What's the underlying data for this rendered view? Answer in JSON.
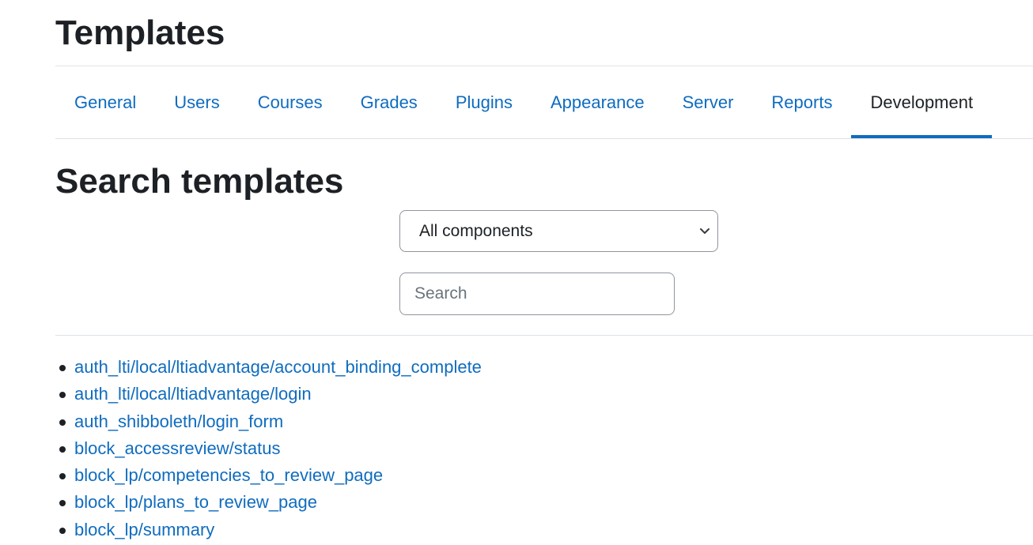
{
  "header": {
    "title": "Templates"
  },
  "tabs": [
    {
      "label": "General",
      "active": false
    },
    {
      "label": "Users",
      "active": false
    },
    {
      "label": "Courses",
      "active": false
    },
    {
      "label": "Grades",
      "active": false
    },
    {
      "label": "Plugins",
      "active": false
    },
    {
      "label": "Appearance",
      "active": false
    },
    {
      "label": "Server",
      "active": false
    },
    {
      "label": "Reports",
      "active": false
    },
    {
      "label": "Development",
      "active": true
    }
  ],
  "search_section": {
    "title": "Search templates",
    "component_select": {
      "selected": "All components",
      "icon": "chevron-down-icon"
    },
    "search_input": {
      "value": "",
      "placeholder": "Search"
    }
  },
  "templates": [
    "auth_lti/local/ltiadvantage/account_binding_complete",
    "auth_lti/local/ltiadvantage/login",
    "auth_shibboleth/login_form",
    "block_accessreview/status",
    "block_lp/competencies_to_review_page",
    "block_lp/plans_to_review_page",
    "block_lp/summary"
  ],
  "colors": {
    "link": "#0f6cbf",
    "text": "#1d2125",
    "active_tab_underline": "#0f6cbf",
    "border": "#dee2e6"
  }
}
